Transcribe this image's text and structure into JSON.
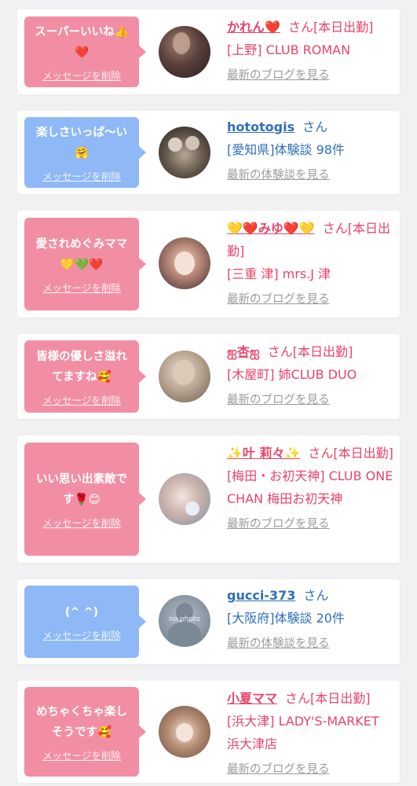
{
  "delete_label": "メッセージを削除",
  "items": [
    {
      "message": "スーパーいいね👍❤️",
      "msg_lines": [
        "スーパーいいね👍",
        "❤️"
      ],
      "name": "かれん❤️",
      "suffix": "さん[本日出勤]",
      "detail": "[上野] CLUB ROMAN",
      "link": "最新のブログを見る"
    },
    {
      "message": "楽しさいっぱ〜い🤗",
      "msg_lines": [
        "楽しさいっぱ〜い",
        "🤗"
      ],
      "name": "hototogis",
      "suffix": "さん",
      "detail": "[愛知県]体験談 98件",
      "link": "最新の体験談を見る"
    },
    {
      "message": "愛されめぐみママ💛💚❤️",
      "msg_lines": [
        "愛されめぐみママ",
        "💛💚❤️"
      ],
      "name": "💛❤️みゆ❤️💛",
      "suffix": "さん[本日出勤]",
      "detail": "[三重 津] mrs.J 津",
      "link": "最新のブログを見る"
    },
    {
      "message": "皆様の優しさ溢れてますね🥰",
      "msg_lines": [
        "皆様の優しさ溢れ",
        "てますね🥰"
      ],
      "name": "ஐ杏ஐ",
      "suffix": "さん[本日出勤]",
      "detail": "[木屋町] 姉CLUB DUO",
      "link": "最新のブログを見る"
    },
    {
      "message": "いい思い出素敵です🌹😊",
      "msg_lines": [
        "いい思い出素敵で",
        "す🌹😊"
      ],
      "name": "✨叶 莉々✨",
      "suffix": "さん[本日出勤]",
      "detail": "[梅田・お初天神] CLUB ONE CHAN 梅田お初天神",
      "link": "最新のブログを見る"
    },
    {
      "message": "(^ ^)",
      "msg_lines": [
        "(^ ^)"
      ],
      "name": "gucci-373",
      "suffix": "さん",
      "detail": "[大阪府]体験談 20件",
      "link": "最新の体験談を見る",
      "avatar_text": "no photo"
    },
    {
      "message": "めちゃくちゃ楽しそうです🥰",
      "msg_lines": [
        "めちゃくちゃ楽し",
        "そうです🥰"
      ],
      "name": "小夏ママ",
      "suffix": "さん[本日出勤]",
      "detail": "[浜大津] LADY'S-MARKET 浜大津店",
      "link": "最新のブログを見る"
    }
  ]
}
